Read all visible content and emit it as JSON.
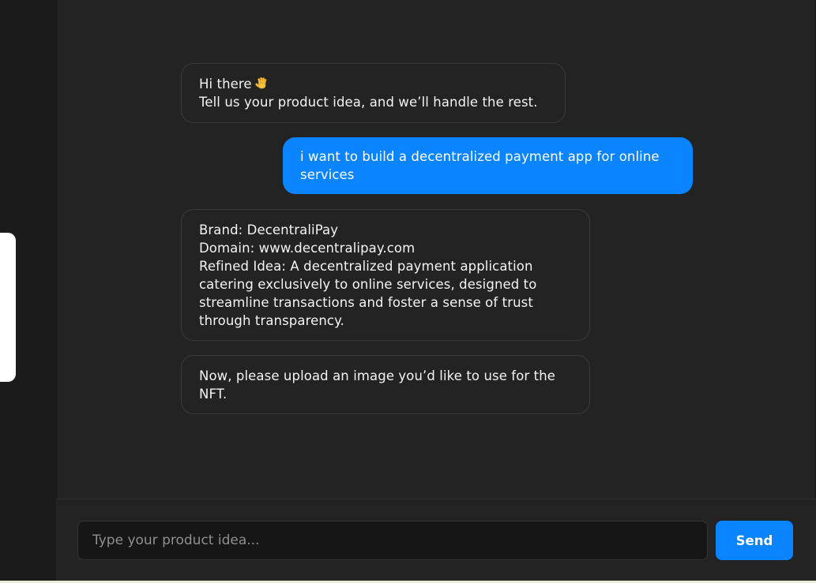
{
  "messages": [
    {
      "role": "bot",
      "line1": "Hi there",
      "icon": "waving-hand-icon",
      "line2": "Tell us your product idea, and we’ll handle the rest."
    },
    {
      "role": "user",
      "text": "i want to build a decentralized payment app for online services"
    },
    {
      "role": "bot",
      "text": "Brand: DecentraliPay\nDomain: www.decentralipay.com\nRefined Idea: A decentralized payment application catering exclusively to online services, designed to streamline transactions and foster a sense of trust through transparency."
    },
    {
      "role": "bot",
      "text": "Now, please upload an image you’d like to use for the NFT."
    }
  ],
  "composer": {
    "placeholder": "Type your product idea...",
    "value": "",
    "send_label": "Send"
  },
  "colors": {
    "accent": "#0a84ff",
    "background": "#232323",
    "sidebar": "#1b1b1b"
  }
}
